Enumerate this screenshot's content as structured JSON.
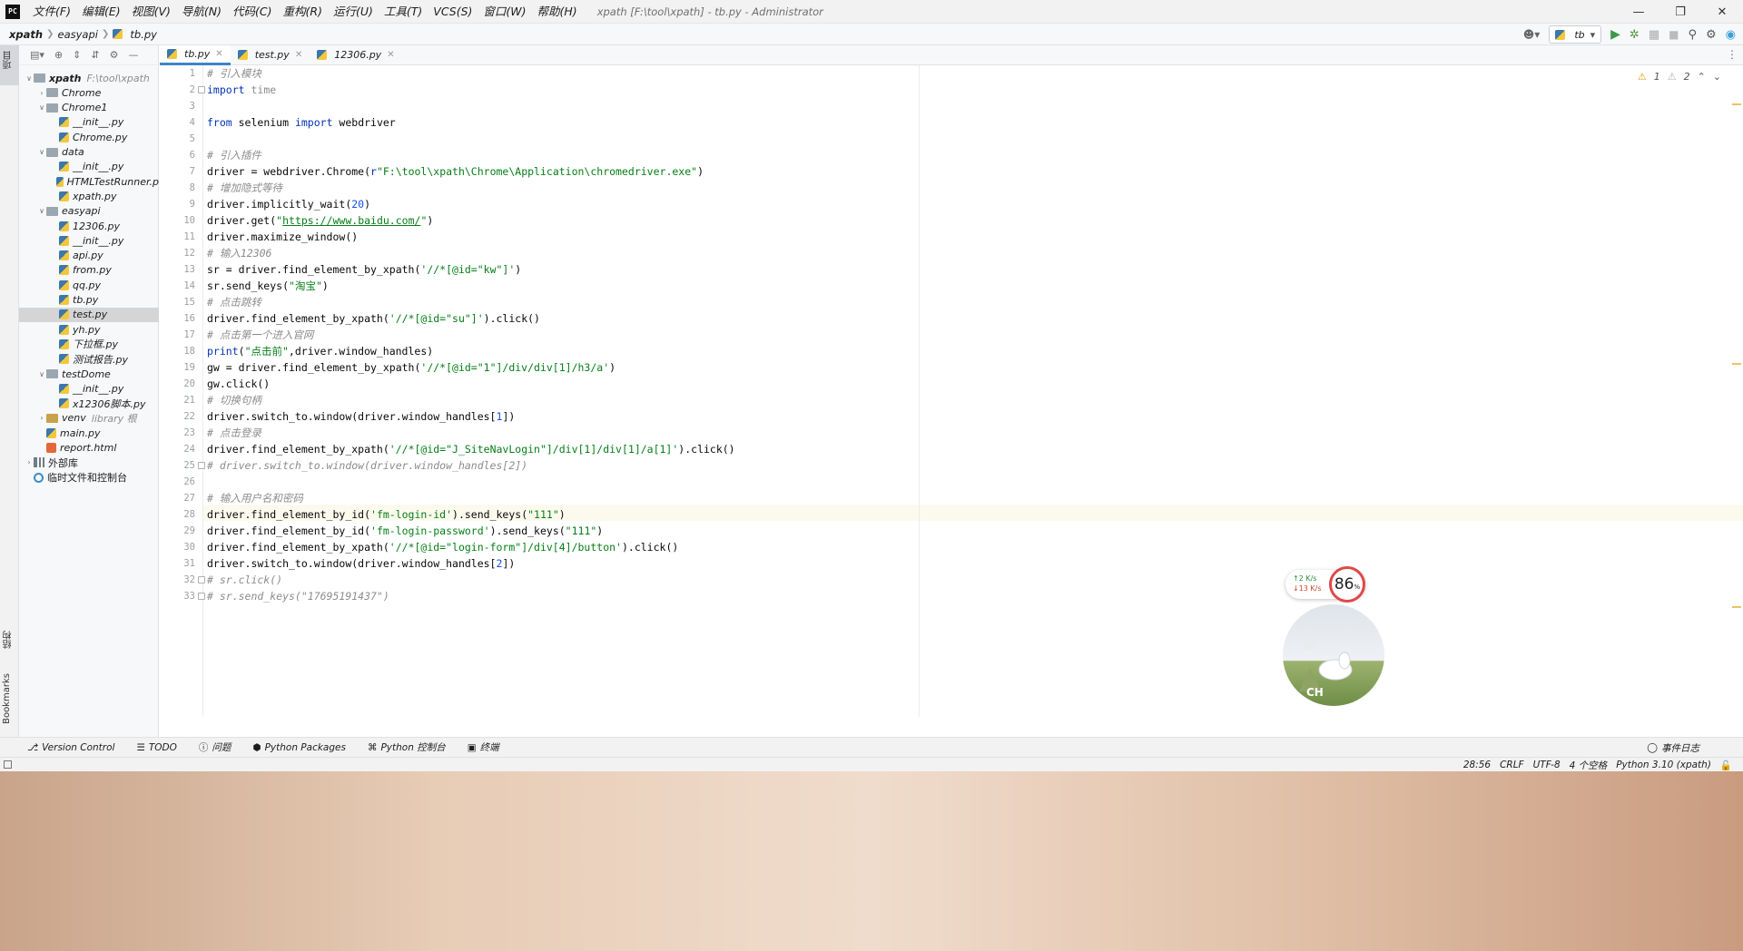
{
  "title_bar": {
    "logo": "PC",
    "menu": [
      "文件(F)",
      "编辑(E)",
      "视图(V)",
      "导航(N)",
      "代码(C)",
      "重构(R)",
      "运行(U)",
      "工具(T)",
      "VCS(S)",
      "窗口(W)",
      "帮助(H)"
    ],
    "window_title": "xpath [F:\\tool\\xpath] - tb.py - Administrator"
  },
  "navbar": {
    "breadcrumbs": [
      "xpath",
      "easyapi",
      "tb.py"
    ],
    "run_config": "tb"
  },
  "left_strip": {
    "project_label": "项目",
    "structure_label": "结构",
    "bookmarks_label": "Bookmarks"
  },
  "project_tree": [
    {
      "depth": 0,
      "arrow": "open",
      "icon": "folder-icon",
      "label": "xpath",
      "hint": "F:\\tool\\xpath"
    },
    {
      "depth": 1,
      "arrow": "closed",
      "icon": "folder-icon",
      "label": "Chrome"
    },
    {
      "depth": 1,
      "arrow": "open",
      "icon": "folder-icon",
      "label": "Chrome1"
    },
    {
      "depth": 2,
      "arrow": "",
      "icon": "python-file-icon",
      "label": "__init__.py"
    },
    {
      "depth": 2,
      "arrow": "",
      "icon": "python-file-icon",
      "label": "Chrome.py"
    },
    {
      "depth": 1,
      "arrow": "open",
      "icon": "folder-icon",
      "label": "data"
    },
    {
      "depth": 2,
      "arrow": "",
      "icon": "python-file-icon",
      "label": "__init__.py"
    },
    {
      "depth": 2,
      "arrow": "",
      "icon": "python-file-icon",
      "label": "HTMLTestRunner.p"
    },
    {
      "depth": 2,
      "arrow": "",
      "icon": "python-file-icon",
      "label": "xpath.py"
    },
    {
      "depth": 1,
      "arrow": "open",
      "icon": "folder-icon",
      "label": "easyapi"
    },
    {
      "depth": 2,
      "arrow": "",
      "icon": "python-file-icon",
      "label": "12306.py"
    },
    {
      "depth": 2,
      "arrow": "",
      "icon": "python-file-icon",
      "label": "__init__.py"
    },
    {
      "depth": 2,
      "arrow": "",
      "icon": "python-file-icon",
      "label": "api.py"
    },
    {
      "depth": 2,
      "arrow": "",
      "icon": "python-file-icon",
      "label": "from.py"
    },
    {
      "depth": 2,
      "arrow": "",
      "icon": "python-file-icon",
      "label": "qq.py"
    },
    {
      "depth": 2,
      "arrow": "",
      "icon": "python-file-icon",
      "label": "tb.py"
    },
    {
      "depth": 2,
      "arrow": "",
      "icon": "python-file-icon",
      "label": "test.py",
      "selected": true
    },
    {
      "depth": 2,
      "arrow": "",
      "icon": "python-file-icon",
      "label": "yh.py"
    },
    {
      "depth": 2,
      "arrow": "",
      "icon": "python-file-icon",
      "label": "下拉框.py"
    },
    {
      "depth": 2,
      "arrow": "",
      "icon": "python-file-icon",
      "label": "测试报告.py"
    },
    {
      "depth": 1,
      "arrow": "open",
      "icon": "folder-icon",
      "label": "testDome"
    },
    {
      "depth": 2,
      "arrow": "",
      "icon": "python-file-icon",
      "label": "__init__.py"
    },
    {
      "depth": 2,
      "arrow": "",
      "icon": "python-file-icon",
      "label": "x12306脚本.py"
    },
    {
      "depth": 1,
      "arrow": "closed",
      "icon": "folder-icon",
      "label": "venv",
      "hint": "library 根",
      "highlight": true
    },
    {
      "depth": 1,
      "arrow": "",
      "icon": "python-file-icon",
      "label": "main.py"
    },
    {
      "depth": 1,
      "arrow": "",
      "icon": "html-file-icon",
      "label": "report.html"
    },
    {
      "depth": 0,
      "arrow": "closed",
      "icon": "library-icon",
      "label": "外部库"
    },
    {
      "depth": 0,
      "arrow": "",
      "icon": "scratch-icon",
      "label": "临时文件和控制台"
    }
  ],
  "editor_tabs": [
    {
      "label": "tb.py",
      "active": true
    },
    {
      "label": "test.py",
      "active": false
    },
    {
      "label": "12306.py",
      "active": false
    }
  ],
  "inspections": {
    "warnings": "1",
    "weak_warnings": "2"
  },
  "code_lines": [
    [
      [
        "cmt",
        "# 引入模块"
      ]
    ],
    [
      [
        "kw",
        "import"
      ],
      [
        "gray",
        " time"
      ]
    ],
    [],
    [
      [
        "kw",
        "from"
      ],
      [
        "",
        " selenium "
      ],
      [
        "kw",
        "import"
      ],
      [
        "",
        " webdriver"
      ]
    ],
    [],
    [
      [
        "cmt",
        "# 引入插件"
      ]
    ],
    [
      [
        "",
        "driver = webdriver.Chrome("
      ],
      [
        "kw",
        "r"
      ],
      [
        "str",
        "\"F:\\tool\\xpath\\Chrome\\Application\\chromedriver.exe\""
      ],
      [
        "",
        ")"
      ]
    ],
    [
      [
        "cmt",
        "# 增加隐式等待"
      ]
    ],
    [
      [
        "",
        "driver.implicitly_wait("
      ],
      [
        "num",
        "20"
      ],
      [
        "",
        ")"
      ]
    ],
    [
      [
        "",
        "driver.get("
      ],
      [
        "str",
        "\""
      ],
      [
        "url",
        "https://www.baidu.com/"
      ],
      [
        "str",
        "\""
      ],
      [
        "",
        ")"
      ]
    ],
    [
      [
        "",
        "driver.maximize_window()"
      ]
    ],
    [
      [
        "cmt",
        "# 输入12306"
      ]
    ],
    [
      [
        "",
        "sr = driver.find_element_by_xpath("
      ],
      [
        "str",
        "'//*[@id=\"kw\"]'"
      ],
      [
        "",
        ")"
      ]
    ],
    [
      [
        "",
        "sr.send_keys("
      ],
      [
        "str",
        "\"淘宝\""
      ],
      [
        "",
        ")"
      ]
    ],
    [
      [
        "cmt",
        "# 点击跳转"
      ]
    ],
    [
      [
        "",
        "driver.find_element_by_xpath("
      ],
      [
        "str",
        "'//*[@id=\"su\"]'"
      ],
      [
        "",
        ").click()"
      ]
    ],
    [
      [
        "cmt",
        "# 点击第一个进入官网"
      ]
    ],
    [
      [
        "kw",
        "print"
      ],
      [
        "",
        "("
      ],
      [
        "str",
        "\"点击前\""
      ],
      [
        "",
        ",driver.window_handles)"
      ]
    ],
    [
      [
        "",
        "gw = driver.find_element_by_xpath("
      ],
      [
        "str",
        "'//*[@id=\"1\"]/div/div[1]/h3/a'"
      ],
      [
        "",
        ")"
      ]
    ],
    [
      [
        "",
        "gw.click()"
      ]
    ],
    [
      [
        "cmt",
        "# 切换句柄"
      ]
    ],
    [
      [
        "",
        "driver.switch_to.window(driver.window_handles["
      ],
      [
        "num",
        "1"
      ],
      [
        "",
        "])"
      ]
    ],
    [
      [
        "cmt",
        "# 点击登录"
      ]
    ],
    [
      [
        "",
        "driver.find_element_by_xpath("
      ],
      [
        "str",
        "'//*[@id=\"J_SiteNavLogin\"]/div[1]/div[1]/a[1]'"
      ],
      [
        "",
        ").click()"
      ]
    ],
    [
      [
        "cmt",
        "# driver.switch_to.window(driver.window_handles[2])"
      ]
    ],
    [],
    [
      [
        "cmt",
        "# 输入用户名和密码"
      ]
    ],
    [
      [
        "",
        "driver.find_element_by_id("
      ],
      [
        "str",
        "'fm-login-id'"
      ],
      [
        "",
        ").send_keys("
      ],
      [
        "str",
        "\"111\""
      ],
      [
        "",
        ")"
      ]
    ],
    [
      [
        "",
        "driver.find_element_by_id("
      ],
      [
        "str",
        "'fm-login-password'"
      ],
      [
        "",
        ").send_keys("
      ],
      [
        "str",
        "\"111\""
      ],
      [
        "",
        ")"
      ]
    ],
    [
      [
        "",
        "driver.find_element_by_xpath("
      ],
      [
        "str",
        "'//*[@id=\"login-form\"]/div[4]/button'"
      ],
      [
        "",
        ").click()"
      ]
    ],
    [
      [
        "",
        "driver.switch_to.window(driver.window_handles["
      ],
      [
        "num",
        "2"
      ],
      [
        "",
        "])"
      ]
    ],
    [
      [
        "cmt",
        "# sr.click()"
      ]
    ],
    [
      [
        "cmt",
        "# sr.send_keys(\"17695191437\")"
      ]
    ]
  ],
  "widgets": {
    "upload_speed": "↑2  K/s",
    "download_speed": "↓13 K/s",
    "cpu_percent": "86",
    "cpu_unit": "%",
    "pet_label": "CH"
  },
  "tool_windows": [
    {
      "icon": "version-control-icon",
      "label": "Version Control"
    },
    {
      "icon": "todo-icon",
      "label": "TODO"
    },
    {
      "icon": "problems-icon",
      "label": "问题"
    },
    {
      "icon": "python-packages-icon",
      "label": "Python Packages"
    },
    {
      "icon": "python-console-icon",
      "label": "Python 控制台"
    },
    {
      "icon": "terminal-icon",
      "label": "终端"
    }
  ],
  "event_log": "事件日志",
  "status_bar": {
    "caret_position": "28:56",
    "line_separator": "CRLF",
    "encoding": "UTF-8",
    "indent": "4 个空格",
    "interpreter": "Python 3.10 (xpath)"
  }
}
